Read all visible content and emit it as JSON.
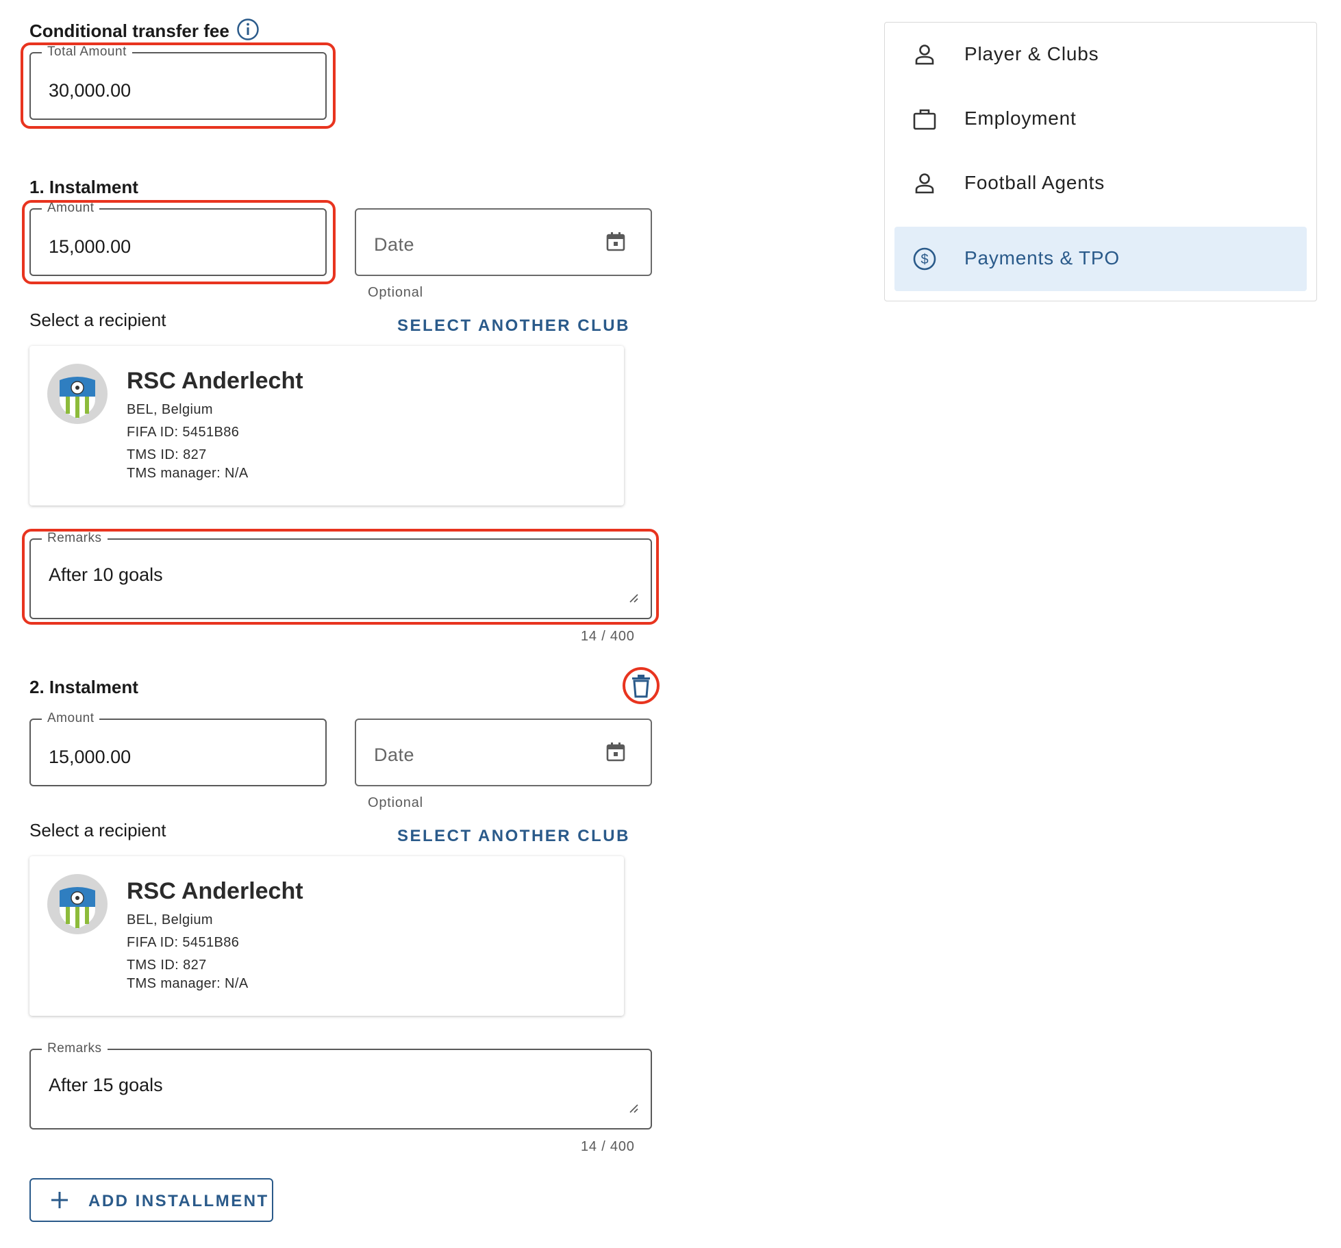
{
  "header": {
    "title": "Conditional transfer fee",
    "total_label": "Total Amount",
    "total_value": "30,000.00"
  },
  "instalments": [
    {
      "title": "1. Instalment",
      "amount_label": "Amount",
      "amount_value": "15,000.00",
      "date_placeholder": "Date",
      "date_helper": "Optional",
      "recipient_label": "Select a recipient",
      "select_club_label": "SELECT ANOTHER CLUB",
      "club": {
        "name": "RSC Anderlecht",
        "country": "BEL, Belgium",
        "fifa_id": "FIFA ID: 5451B86",
        "tms_id": "TMS ID: 827",
        "tms_manager": "TMS manager: N/A"
      },
      "remarks_label": "Remarks",
      "remarks_value": "After 10 goals",
      "remarks_counter": "14 / 400"
    },
    {
      "title": "2. Instalment",
      "amount_label": "Amount",
      "amount_value": "15,000.00",
      "date_placeholder": "Date",
      "date_helper": "Optional",
      "recipient_label": "Select a recipient",
      "select_club_label": "SELECT ANOTHER CLUB",
      "club": {
        "name": "RSC Anderlecht",
        "country": "BEL, Belgium",
        "fifa_id": "FIFA ID: 5451B86",
        "tms_id": "TMS ID: 827",
        "tms_manager": "TMS manager: N/A"
      },
      "remarks_label": "Remarks",
      "remarks_value": "After 15 goals",
      "remarks_counter": "14 / 400"
    }
  ],
  "add_button_label": "ADD INSTALLMENT",
  "sidebar": {
    "items": [
      {
        "label": "Player & Clubs",
        "icon": "person-icon",
        "active": false
      },
      {
        "label": "Employment",
        "icon": "briefcase-icon",
        "active": false
      },
      {
        "label": "Football Agents",
        "icon": "person-icon",
        "active": false
      },
      {
        "label": "Payments & TPO",
        "icon": "dollar-circle-icon",
        "active": true
      }
    ]
  },
  "colors": {
    "accent": "#2a5a8a",
    "highlight": "#e8341f",
    "active_bg": "#e3eef9"
  }
}
